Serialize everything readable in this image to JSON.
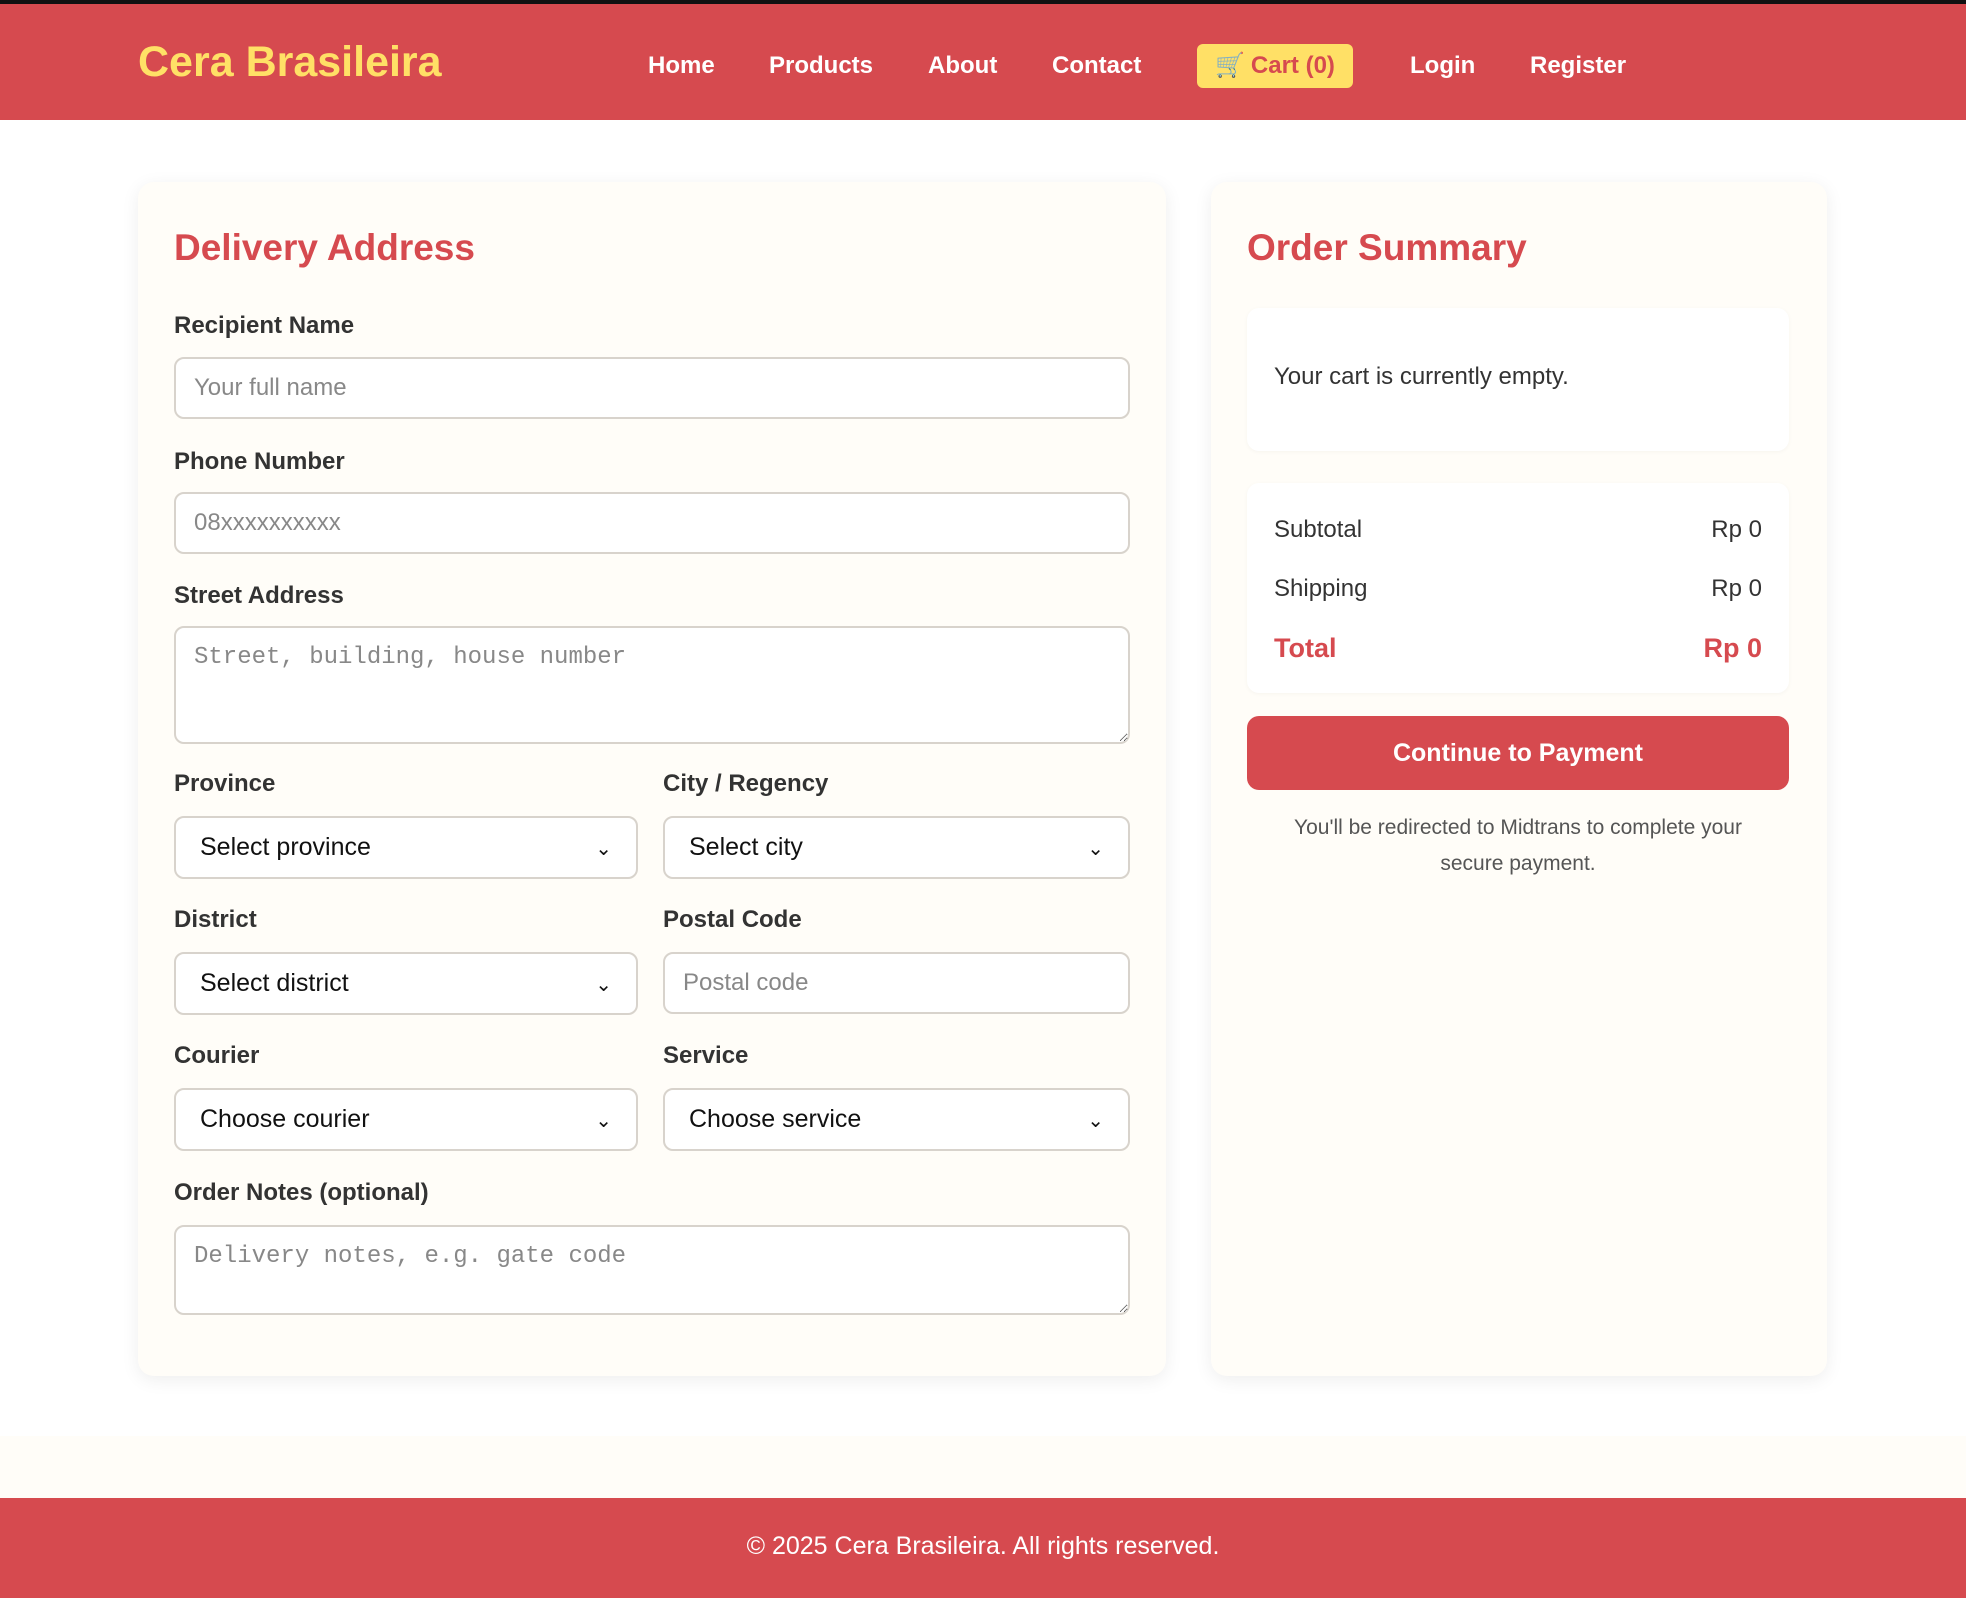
{
  "brand": {
    "name": "Cera Brasileira",
    "color": "#ffe066",
    "primary_color": "#d64a4f"
  },
  "nav": {
    "home": "Home",
    "products": "Products",
    "about": "About",
    "contact": "Contact",
    "cart": "Cart (0)",
    "cart_icon": "shopping-cart-icon",
    "login": "Login",
    "register": "Register"
  },
  "delivery": {
    "title": "Delivery Address",
    "recipient_label": "Recipient Name",
    "recipient_placeholder": "Your full name",
    "phone_label": "Phone Number",
    "phone_placeholder": "08xxxxxxxxxx",
    "street_label": "Street Address",
    "street_placeholder": "Street, building, house number",
    "province_label": "Province",
    "province_value": "Select province",
    "city_label": "City / Regency",
    "city_value": "Select city",
    "district_label": "District",
    "district_value": "Select district",
    "postal_label": "Postal Code",
    "postal_placeholder": "Postal code",
    "courier_label": "Courier",
    "courier_value": "Choose courier",
    "service_label": "Service",
    "service_value": "Choose service",
    "notes_label": "Order Notes (optional)",
    "notes_placeholder": "Delivery notes, e.g. gate code"
  },
  "summary": {
    "title": "Order Summary",
    "empty_text": "Your cart is currently empty.",
    "subtotal_label": "Subtotal",
    "subtotal_value": "Rp 0",
    "shipping_label": "Shipping",
    "shipping_value": "Rp 0",
    "total_label": "Total",
    "total_value": "Rp 0",
    "pay_button": "Continue to Payment",
    "pay_note": "You'll be redirected to Midtrans to complete your secure payment."
  },
  "footer": {
    "copyright": "© 2025 Cera Brasileira. All rights reserved."
  }
}
